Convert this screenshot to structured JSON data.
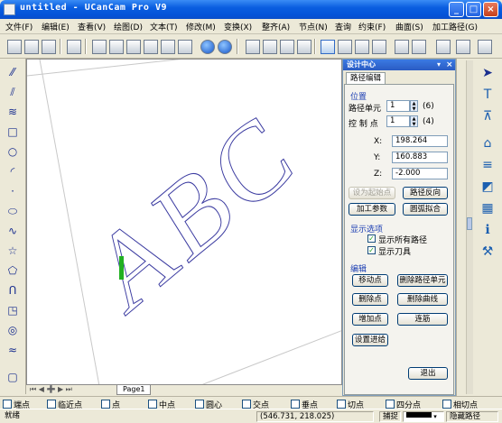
{
  "window": {
    "title": "untitled - UCanCam Pro V9"
  },
  "menu": [
    "文件(F)",
    "编辑(E)",
    "查看(V)",
    "绘图(D)",
    "文本(T)",
    "修改(M)",
    "变换(X)",
    "整齐(A)",
    "节点(N)",
    "查询",
    "约束(F)",
    "曲面(S)",
    "加工路径(G)"
  ],
  "panel": {
    "title": "设计中心",
    "tab": "路径编辑",
    "position_group": "位置",
    "path_unit_label": "路径单元",
    "path_unit_value": "1",
    "path_unit_count": "(6)",
    "ctrl_point_label": "控 制 点",
    "ctrl_point_value": "1",
    "ctrl_point_count": "(4)",
    "x_label": "X:",
    "x_value": "198.264",
    "y_label": "Y:",
    "y_value": "160.883",
    "z_label": "Z:",
    "z_value": "-2.000",
    "btn_set_start": "设为起始点",
    "btn_reverse": "路径反向",
    "btn_params": "加工参数",
    "btn_arc_fit": "圆弧拟合",
    "display_group": "显示选项",
    "show_all_paths": "显示所有路径",
    "show_tool": "显示刀具",
    "edit_group": "编辑",
    "btn_move_point": "移动点",
    "btn_delete_path_unit": "删除路径单元",
    "btn_delete_point": "删除点",
    "btn_delete_curve": "删除曲线",
    "btn_add_point": "增加点",
    "btn_connect": "连筋",
    "btn_set_feed": "设置进给",
    "btn_exit": "退出"
  },
  "canvas": {
    "text": "ABC",
    "page_tab": "Page1"
  },
  "snaps": [
    "端点",
    "临近点",
    "点",
    "中点",
    "圆心",
    "交点",
    "垂点",
    "切点",
    "四分点",
    "相切点"
  ],
  "status": {
    "ready": "就绪",
    "coords": "(546.731,   218.025)",
    "snap": "捕捉",
    "hide_path": "隐藏路径"
  },
  "colors": {
    "title_blue": "#0a5ee0",
    "path_blue": "#3a3aa0",
    "tool_green": "#22b022"
  }
}
